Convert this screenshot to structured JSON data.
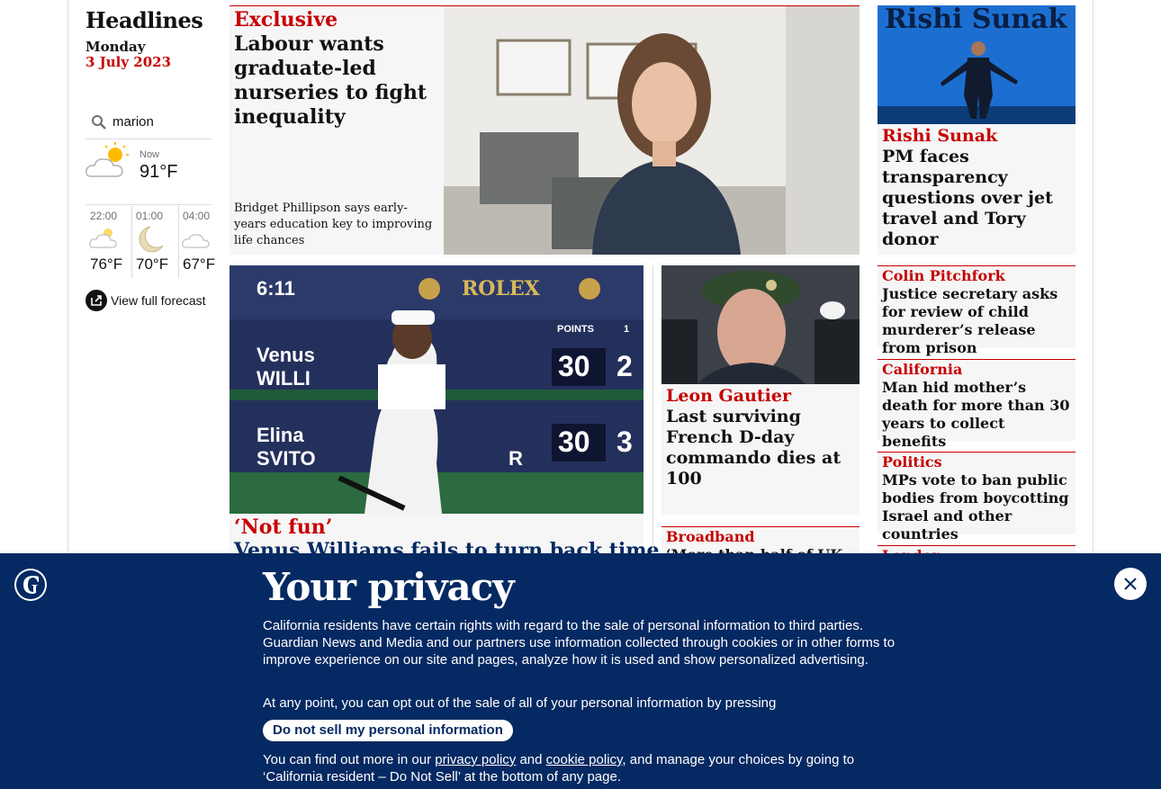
{
  "sidebar": {
    "title": "Headlines",
    "day": "Monday",
    "date": "3 July 2023",
    "location": "marion",
    "weather_now_label": "Now",
    "weather_now_temp": "91°F",
    "forecast": [
      {
        "time": "22:00",
        "temp": "76°F",
        "icon": "cloud-icon"
      },
      {
        "time": "01:00",
        "temp": "70°F",
        "icon": "moon-icon"
      },
      {
        "time": "04:00",
        "temp": "67°F",
        "icon": "cloud-icon"
      }
    ],
    "full_forecast": "View full forecast"
  },
  "main": {
    "top": {
      "kicker": "Exclusive",
      "headline": "Labour wants graduate-led nurseries to fight inequality",
      "standfirst": "Bridget Phillipson says early-years education key to improving life chances"
    },
    "venus": {
      "kicker": "‘Not fun’",
      "headline": "Venus Williams fails to turn back time on"
    },
    "gautier": {
      "kicker": "Leon Gautier",
      "headline": "Last surviving French D-day commando dies at 100"
    },
    "broadband": {
      "kicker": "Broadband",
      "headline": "‘More than half of UK"
    },
    "sunak": {
      "kicker": "Rishi Sunak",
      "headline": "PM faces transparency questions over jet travel and Tory donor",
      "image_text": "Rishi Sunak"
    },
    "pitchfork": {
      "kicker": "Colin Pitchfork",
      "headline": "Justice secretary asks for review of child murderer’s release from prison"
    },
    "california": {
      "kicker": "California",
      "headline": "Man hid mother’s death for more than 30 years to collect benefits"
    },
    "politics": {
      "kicker": "Politics",
      "headline": "MPs vote to ban public bodies from boycotting Israel and other countries"
    },
    "london": {
      "kicker": "London"
    },
    "scoreboard": {
      "time": "6:11",
      "brand": "ROLEX",
      "points": "POINTS",
      "set_col": "1",
      "p1a": "Venus",
      "p1b": "WILLI",
      "p1_pts": "30",
      "p1_games": "2",
      "p2a": "Elina",
      "p2b": "SVITO",
      "p2_pts": "30",
      "p2_games": "3",
      "p2_suffix": "R"
    }
  },
  "privacy": {
    "title": "Your privacy",
    "para1": "California residents have certain rights with regard to the sale of personal information to third parties. Guardian News and Media and our partners use information collected through cookies or in other forms to improve experience on our site and pages, analyze how it is used and show personalized advertising.",
    "para2": "At any point, you can opt out of the sale of all of your personal information by pressing",
    "button": "Do not sell my personal information",
    "para3_a": "You can find out more in our ",
    "link1": "privacy policy",
    "para3_b": " and ",
    "link2": "cookie policy",
    "para3_c": ", and manage your choices by going to ‘California resident – Do Not Sell’ at the bottom of any page."
  },
  "colors": {
    "brand_blue": "#052962",
    "news_red": "#c70000",
    "card_bg": "#f6f6f6"
  }
}
